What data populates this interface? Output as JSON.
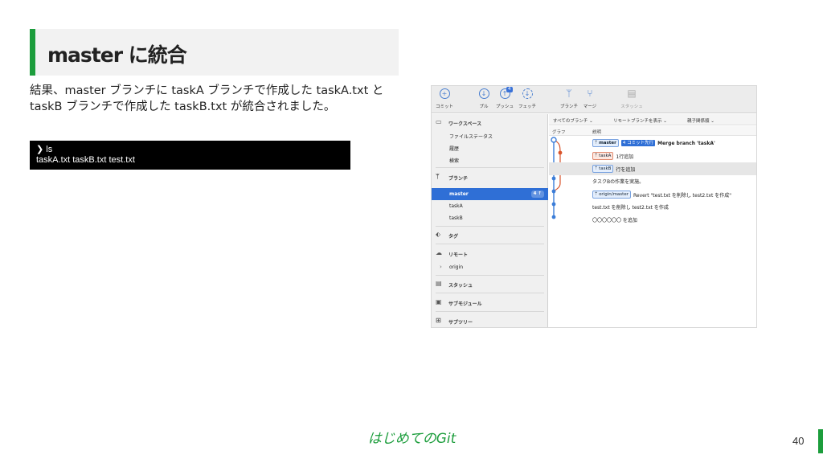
{
  "slide": {
    "title": "master に統合",
    "body": "結果、master ブランチに taskA ブランチで作成した taskA.txt と taskB ブランチで作成した taskB.txt が統合されました。",
    "terminal_lines": [
      "❯ ls",
      "taskA.txt taskB.txt test.txt"
    ],
    "footer": "はじめてのGit",
    "page_number": "40",
    "accent_color": "#1c9d3c"
  },
  "app": {
    "toolbar": [
      {
        "label": "コミット",
        "icon": "plus-icon"
      },
      {
        "label": "プル",
        "icon": "pull-icon"
      },
      {
        "label": "プッシュ",
        "icon": "push-icon",
        "badge": "4"
      },
      {
        "label": "フェッチ",
        "icon": "fetch-icon"
      },
      {
        "label": "ブランチ",
        "icon": "branch-icon"
      },
      {
        "label": "マージ",
        "icon": "merge-icon"
      },
      {
        "label": "スタッシュ",
        "icon": "stash-icon"
      }
    ],
    "sidebar": {
      "workspace": "ワークスペース",
      "file_status": "ファイルステータス",
      "history": "履歴",
      "search": "検索",
      "branches": "ブランチ",
      "branch_items": [
        {
          "label": "master",
          "count": "4 ↑"
        },
        {
          "label": "taskA"
        },
        {
          "label": "taskB"
        }
      ],
      "tags": "タグ",
      "remotes": "リモート",
      "remote_item": "origin",
      "stash": "スタッシュ",
      "submodules": "サブモジュール",
      "subtrees": "サブツリー"
    },
    "filters": {
      "branches": "すべてのブランチ ⌄",
      "show_remote": "リモートブランチを表示 ⌄",
      "order": "親子関係順 ⌄"
    },
    "columns": {
      "graph": "グラフ",
      "description": "説明"
    },
    "commits": [
      {
        "tag": "master",
        "ahead": "4 コミット先行",
        "message": "Merge branch 'taskA'",
        "tag_color": "#e4eefc"
      },
      {
        "tag": "taskA",
        "message": "1行追加",
        "tag_color": "#fde8e0"
      },
      {
        "tag": "taskB",
        "message": "行を追加",
        "tag_color": "#e4eefc"
      },
      {
        "message": "タスクBの作業を実施。"
      },
      {
        "tag": "origin/master",
        "message": "Revert \"test.txt を削除し test2.txt を作成\"",
        "tag_color": "#e4eefc"
      },
      {
        "message": "test.txt を削除し test2.txt を作成"
      },
      {
        "message": "〇〇〇〇〇〇 を追加"
      }
    ]
  }
}
